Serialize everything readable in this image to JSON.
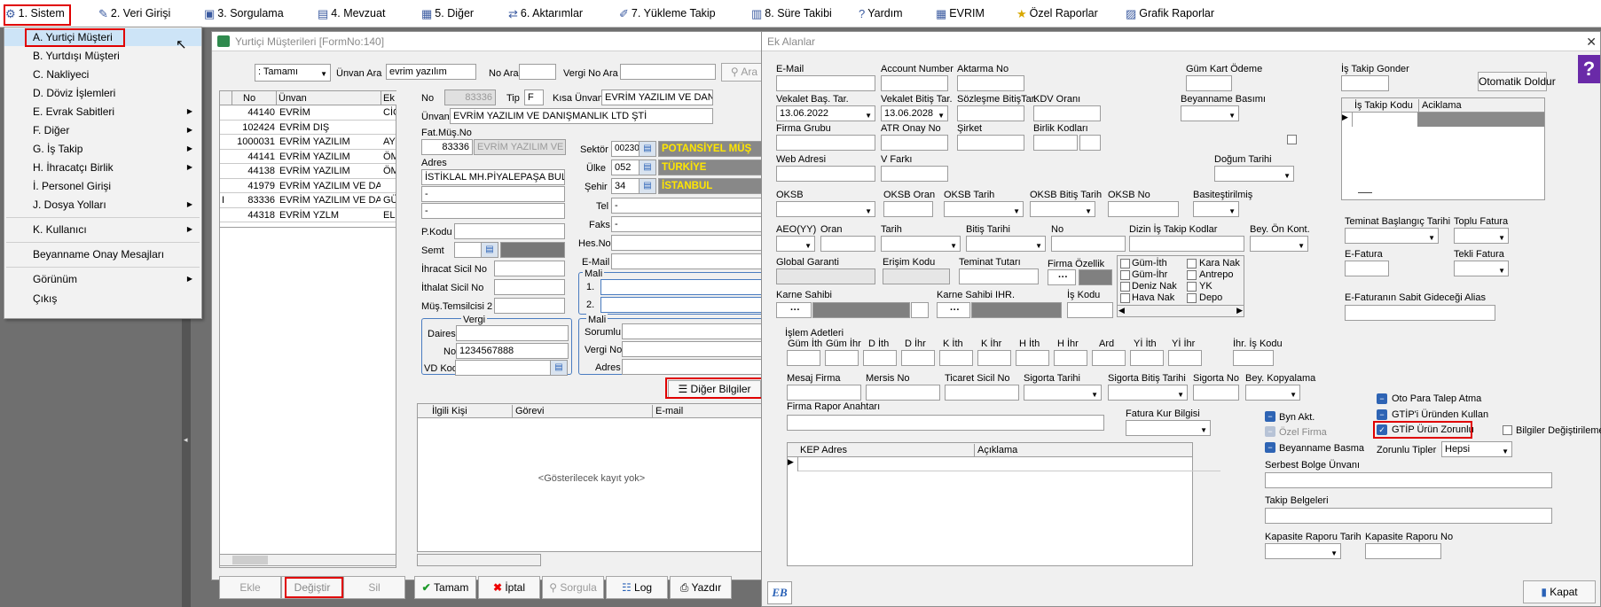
{
  "menubar": {
    "items": [
      {
        "label": "1.  Sistem"
      },
      {
        "label": "2.  Veri Girişi"
      },
      {
        "label": "3.  Sorgulama"
      },
      {
        "label": "4.  Mevzuat"
      },
      {
        "label": "5.  Diğer"
      },
      {
        "label": "6.  Aktarımlar"
      },
      {
        "label": "7.  Yükleme Takip"
      },
      {
        "label": "8. Süre Takibi"
      },
      {
        "label": "Yardım"
      },
      {
        "label": "EVRIM"
      },
      {
        "label": "Özel Raporlar"
      },
      {
        "label": "Grafik Raporlar"
      }
    ]
  },
  "sistem_menu": {
    "items": [
      {
        "label": "A.  Yurtiçi Müşteri"
      },
      {
        "label": "B.  Yurtdışı Müşteri"
      },
      {
        "label": "C.  Nakliyeci"
      },
      {
        "label": "D.  Döviz İşlemleri"
      },
      {
        "label": "E.  Evrak Sabitleri"
      },
      {
        "label": "F.  Diğer"
      },
      {
        "label": "G.  İş Takip"
      },
      {
        "label": "H.  İhracatçı Birlik"
      },
      {
        "label": "İ.  Personel Girişi"
      },
      {
        "label": "J.  Dosya Yolları"
      },
      {
        "label": "K.  Kullanıcı"
      },
      {
        "label": "Beyanname Onay Mesajları"
      },
      {
        "label": "Görünüm"
      },
      {
        "label": "Çıkış"
      }
    ]
  },
  "musteri_form": {
    "title": "Yurtiçi Müşterileri [FormNo:140]",
    "filter_select": ": Tamamı",
    "unvan_ara_label": "Ünvan Ara",
    "unvan_ara_value": "evrim yazılım",
    "no_ara_label": "No Ara",
    "vergi_no_ara_label": "Vergi No Ara",
    "ara_label": "Ara",
    "grid_headers": {
      "no": "No",
      "unvan": "Ünvan",
      "extra": "Ek"
    },
    "rows": [
      {
        "marker": "",
        "no": "44140",
        "unvan": "EVRİM",
        "extra": "CİC"
      },
      {
        "marker": "",
        "no": "102424",
        "unvan": "EVRİM DIŞ",
        "extra": ""
      },
      {
        "marker": "",
        "no": "1000031",
        "unvan": "EVRİM YAZILIM",
        "extra": "AY"
      },
      {
        "marker": "",
        "no": "44141",
        "unvan": "EVRİM YAZILIM",
        "extra": "ÖM"
      },
      {
        "marker": "",
        "no": "44138",
        "unvan": "EVRİM YAZILIM",
        "extra": "ÖM"
      },
      {
        "marker": "",
        "no": "41979",
        "unvan": "EVRİM YAZILIM VE DA",
        "extra": ""
      },
      {
        "marker": "I",
        "no": "83336",
        "unvan": "EVRİM YAZILIM VE DAN",
        "extra": "GÜ"
      },
      {
        "marker": "",
        "no": "44318",
        "unvan": "EVRİM YZLM",
        "extra": "EL"
      }
    ],
    "no_label": "No",
    "no_value": "83336",
    "tip_label": "Tip",
    "tip_value": "F",
    "kisa_unvan_label": "Kısa Ünvanı",
    "kisa_unvan_value": "EVRİM YAZILIM VE DAN",
    "unvani_label": "Ünvanı",
    "unvani_value": "EVRİM YAZILIM VE DANIŞMANLIK LTD ŞTİ",
    "fat_mus_no_label": "Fat.Müş.No",
    "fat_mus_no_value": "83336",
    "fat_mus_name": "EVRİM YAZILIM VE",
    "adres_label": "Adres",
    "adres_1": "İSTİKLAL MH.PİYALEPAŞA BUL",
    "adres_2": "-",
    "adres_3": "-",
    "pkodu_label": "P.Kodu",
    "semt_label": "Semt",
    "ihracat_sicil_label": "İhracat Sicil No",
    "ithalat_sicil_label": "İthalat Sicil No",
    "mus_temsilcisi_label": "Müş.Temsilcisi 2",
    "sektor_label": "Sektör",
    "sektor_code": "00230",
    "sektor_name": "POTANSİYEL MÜŞ",
    "ulke_label": "Ülke",
    "ulke_code": "052",
    "ulke_name": "TÜRKİYE",
    "sehir_label": "Şehir",
    "sehir_code": "34",
    "sehir_name": "İSTANBUL",
    "tel_label": "Tel",
    "tel_value": "-",
    "faks_label": "Faks",
    "faks_value": "-",
    "hes_no_label": "Hes.No",
    "email_label": "E-Mail",
    "mali_label": "Mali",
    "mali_1_label": "1.",
    "mali_2_label": "2.",
    "vergi_group_label": "Vergi",
    "vergi_dairesi_label": "Dairesi",
    "vergi_no_label": "No",
    "vergi_no_value": "1234567888",
    "vd_kod_label": "VD Kod",
    "mali_sorumlu_label_1": "Mali",
    "mali_sorumlu_label_2": "Sorumlu",
    "ms_vergi_no_label": "Vergi No",
    "ms_adres_label": "Adres",
    "diger_bilgiler_label": "Diğer Bilgiler",
    "kisi_headers": {
      "kisi": "İlgili Kişi",
      "gorevi": "Görevi",
      "email": "E-mail"
    },
    "empty_text": "<Gösterilecek kayıt yok>",
    "buttons": {
      "ekle": "Ekle",
      "degistir": "Değiştir",
      "sil": "Sil",
      "tamam": "Tamam",
      "iptal": "İptal",
      "sorgula": "Sorgula",
      "log": "Log",
      "yazdir": "Yazdır"
    }
  },
  "ek_alanlar": {
    "title": "Ek Alanlar",
    "email_label": "E-Mail",
    "account_number_label": "Account Number",
    "aktarma_no_label": "Aktarma No",
    "gum_kart_odeme_label": "Güm Kart Ödeme",
    "is_takip_gonder_label": "İş Takip Gonder",
    "otomatik_doldur_label": "Otomatik Doldur",
    "vekalet_bas_label": "Vekalet Baş. Tar.",
    "vekalet_bas_value": "13.06.2022",
    "vekalet_bitis_label": "Vekalet Bitiş Tar.",
    "vekalet_bitis_value": "13.06.2028",
    "sozlesme_bitis_label": "Sözleşme BitişTar.",
    "kdv_orani_label": "KDV Oranı",
    "beyanname_basimi_label": "Beyanname Basımı",
    "is_takip_headers": {
      "kod": "İş Takip Kodu",
      "aciklama": "Aciklama"
    },
    "firma_grubu_label": "Firma Grubu",
    "atr_onay_label": "ATR Onay No",
    "sirket_label": "Şirket",
    "birlik_kodlari_label": "Birlik Kodları",
    "web_adresi_label": "Web Adresi",
    "v_farki_label": "V Farkı",
    "dogum_tarihi_label": "Doğum Tarihi",
    "okbs_label": "OKSB",
    "okbs_oran_label": "OKSB Oran",
    "okbs_tarih_label": "OKSB Tarih",
    "okbs_bitis_label": "OKSB Bitiş Tarih",
    "okbs_no_label": "OKSB No",
    "basitestirilmis_label": "Basiteştirilmiş",
    "teminat_bas_label": "Teminat Başlangıç Tarihi",
    "toplu_fatura_label": "Toplu Fatura",
    "aeo_label": "AEO(YY)",
    "oran_label": "Oran",
    "tarih_label": "Tarih",
    "bitis_tarihi_label": "Bitiş Tarihi",
    "no_label": "No",
    "dizin_label": "Dizin İş Takip Kodlar",
    "bey_on_kont_label": "Bey. Ön Kont.",
    "efatura_label": "E-Fatura",
    "tekli_fatura_label": "Tekli Fatura",
    "global_garanti_label": "Global Garanti",
    "erisim_kodu_label": "Erişim Kodu",
    "teminat_tutari_label": "Teminat Tutarı",
    "firma_ozellik_label": "Firma Özellik",
    "checks": [
      {
        "label": "Güm-İth"
      },
      {
        "label": "Güm-İhr"
      },
      {
        "label": "Deniz Nak"
      },
      {
        "label": "Hava Nak"
      },
      {
        "label": "Kara Nak"
      },
      {
        "label": "Antrepo"
      },
      {
        "label": "YK"
      },
      {
        "label": "Depo"
      }
    ],
    "karne_sahibi_label": "Karne Sahibi",
    "karne_sahibi_ihr_label": "Karne Sahibi IHR.",
    "is_kodu_label": "İş Kodu",
    "efatura_alias_label": "E-Faturanın Sabit Gideceği Alias",
    "islem_adetleri_label": "İşlem Adetleri",
    "islem_cols": [
      {
        "label": "Güm İth"
      },
      {
        "label": "Güm İhr"
      },
      {
        "label": "D İth"
      },
      {
        "label": "D İhr"
      },
      {
        "label": "K İth"
      },
      {
        "label": "K İhr"
      },
      {
        "label": "H İth"
      },
      {
        "label": "H İhr"
      },
      {
        "label": "Ard"
      },
      {
        "label": "Yİ İth"
      },
      {
        "label": "Yİ İhr"
      }
    ],
    "ihr_is_kodu_label": "İhr. İş Kodu",
    "mesaj_firma_label": "Mesaj Firma",
    "mersis_no_label": "Mersis No",
    "ticaret_sicil_label": "Ticaret Sicil No",
    "sigorta_tarihi_label": "Sigorta Tarihi",
    "sigorta_bitis_label": "Sigorta Bitiş Tarihi",
    "sigorta_no_label": "Sigorta No",
    "bey_kopyalama_label": "Bey. Kopyalama",
    "oto_para_label": "Oto Para Talep Atma",
    "firma_rapor_label": "Firma Rapor Anahtarı",
    "fatura_kur_label": "Fatura Kur Bilgisi",
    "byn_akt_label": "Byn Akt.",
    "gtip_urunden_label": "GTİP'i Üründen Kullan",
    "ozel_firma_label": "Özel Firma",
    "gtip_urun_zorunlu_label": "GTİP Ürün Zorunlu",
    "bilgiler_degistirileme_label": "Bilgiler Değiştirileme",
    "beyanname_basma_label": "Beyanname Basma",
    "zorunlu_tipler_label": "Zorunlu Tipler",
    "zorunlu_tipler_value": "Hepsi",
    "kep_headers": {
      "adres": "KEP Adres",
      "aciklama": "Açıklama"
    },
    "serbest_bolge_label": "Serbest Bolge Ünvanı",
    "takip_belgeleri_label": "Takip Belgeleri",
    "kapasite_tarih_label": "Kapasite Raporu Tarih",
    "kapasite_no_label": "Kapasite Raporu No",
    "kapat_label": "Kapat",
    "help_icon_text": "?",
    "logo_text": "EB"
  }
}
